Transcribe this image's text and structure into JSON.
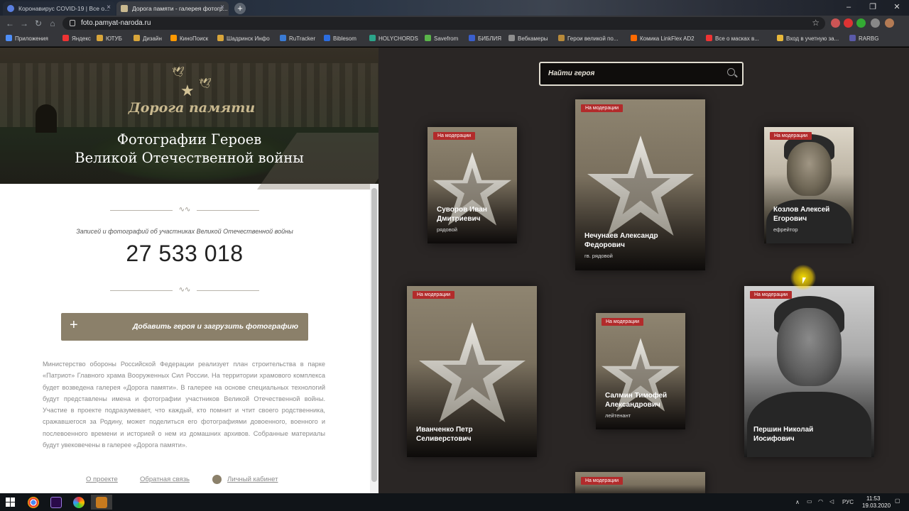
{
  "browser": {
    "tabs": [
      {
        "title": "Коронавирус COVID-19 | Все о...",
        "active": false
      },
      {
        "title": "Дорога памяти - галерея фотогр...",
        "active": true
      }
    ],
    "address": "foto.pamyat-naroda.ru",
    "bookmarks": [
      "Приложения",
      "Яндекс",
      "ЮТУБ",
      "Дизайн",
      "КиноПоиск",
      "Шадринск Инфо",
      "RuTracker",
      "Biblesom",
      "HOLYCHORDS",
      "Savefrom",
      "БИБЛИЯ",
      "Вебкамеры",
      "Герои великой по...",
      "Комика LinkFlex AD2",
      "Все о масках в...",
      "Вход в учетную за...",
      "RARBG"
    ],
    "bookmark_colors": [
      "#4e8ef7",
      "#e33",
      "#d8a53a",
      "#d8a53a",
      "#f90",
      "#d8a53a",
      "#3a7bd5",
      "#2b6de0",
      "#2ba58a",
      "#5ab54a",
      "#3a5fcd",
      "#8e8e8e",
      "#b88a3a",
      "#ff6a00",
      "#e33",
      "#e8b83a",
      "#5a5aa8"
    ]
  },
  "hero": {
    "logo_text": "Дорога памяти",
    "title_line1": "Фотографии Героев",
    "title_line2": "Великой Отечественной войны"
  },
  "stats": {
    "caption": "Записей и фотографий об участниках Великой Отечественной войны",
    "count": "27 533 018"
  },
  "add_button_label": "Добавить героя и загрузить фотографию",
  "description": "Министерство обороны Российской Федерации реализует план строительства в парке «Патриот» Главного храма Вооруженных Сил России. На территории храмового комплекса будет возведена галерея «Дорога памяти». В галерее на основе специальных технологий будут представлены имена и фотографии участников Великой Отечественной войны. Участие в проекте подразумевает, что каждый, кто помнит и чтит своего родственника, сражавшегося за Родину, может поделиться его фотографиями довоенного, военного и послевоенного времени и историей о нем из домашних архивов. Собранные материалы будут увековечены в галерее «Дорога памяти».",
  "footer": {
    "about": "О проекте",
    "feedback": "Обратная связь",
    "cabinet": "Личный кабинет"
  },
  "search": {
    "placeholder": "Найти героя"
  },
  "cards": [
    {
      "badge": "На модерации",
      "name_line1": "Суворов Иван",
      "name_line2": "Дмитриевич",
      "rank": "рядовой",
      "type": "star"
    },
    {
      "badge": "На модерации",
      "name_line1": "Нечунаев Александр",
      "name_line2": "Федорович",
      "rank": "гв. рядовой",
      "type": "star"
    },
    {
      "badge": "На модерации",
      "name_line1": "Козлов Алексей",
      "name_line2": "Егорович",
      "rank": "ефрейтор",
      "type": "photo"
    },
    {
      "badge": "На модерации",
      "name_line1": "Иванченко Петр",
      "name_line2": "Селиверстович",
      "rank": "",
      "type": "star"
    },
    {
      "badge": "На модерации",
      "name_line1": "Салмин Тимофей",
      "name_line2": "Александрович",
      "rank": "лейтенант",
      "type": "star"
    },
    {
      "badge": "На модерации",
      "name_line1": "Першин Николай",
      "name_line2": "Иосифович",
      "rank": "",
      "type": "photo"
    },
    {
      "badge": "На модерации",
      "name_line1": "",
      "name_line2": "",
      "rank": "",
      "type": "star"
    }
  ],
  "taskbar": {
    "lang": "РУС",
    "time": "11:53",
    "date": "19.03.2020"
  },
  "colors": {
    "accent": "#8b806a",
    "badge": "#b22b2b",
    "page_dark": "#2a2625"
  }
}
